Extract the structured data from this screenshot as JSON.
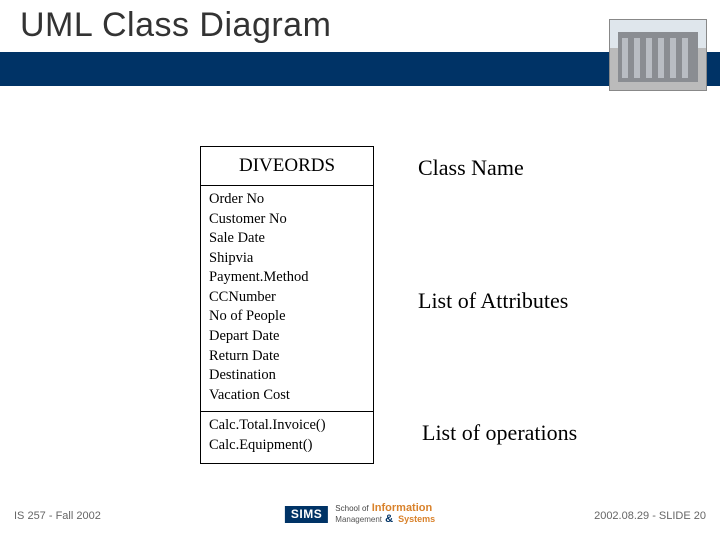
{
  "title": "UML Class Diagram",
  "uml": {
    "class_name": "DIVEORDS",
    "attributes": [
      "Order No",
      "Customer No",
      "Sale Date",
      "Shipvia",
      "Payment.Method",
      "CCNumber",
      "No of People",
      "Depart Date",
      "Return Date",
      "Destination",
      "Vacation Cost"
    ],
    "operations": [
      "Calc.Total.Invoice()",
      "Calc.Equipment()"
    ]
  },
  "labels": {
    "class": "Class Name",
    "attrs": "List of Attributes",
    "ops": "List of operations"
  },
  "footer": {
    "left": "IS 257 - Fall 2002",
    "right": "2002.08.29 - SLIDE 20",
    "logo": {
      "box": "SIMS",
      "top": "School of",
      "info": "Information",
      "mgmt": "Management",
      "amp": "&",
      "sys": "Systems"
    }
  }
}
